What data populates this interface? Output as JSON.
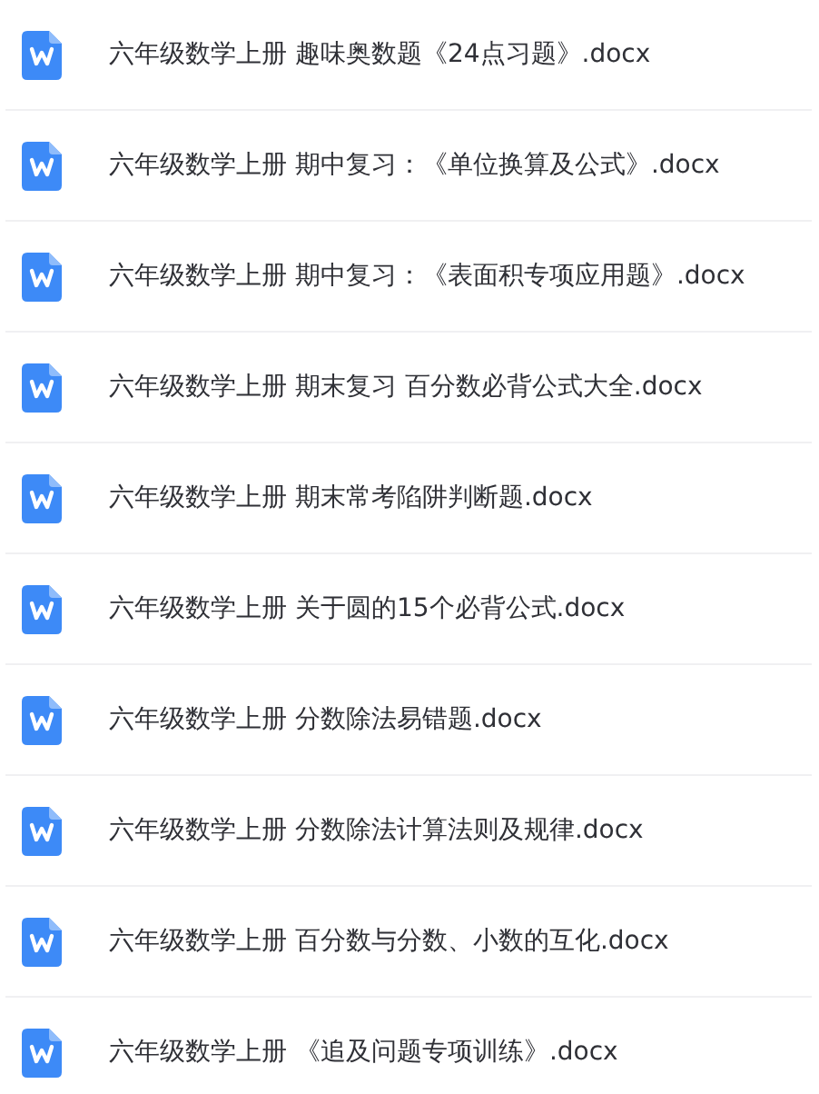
{
  "files": [
    {
      "name": "六年级数学上册 趣味奥数题《24点习题》.docx"
    },
    {
      "name": "六年级数学上册 期中复习：《单位换算及公式》.docx"
    },
    {
      "name": "六年级数学上册 期中复习：《表面积专项应用题》.docx"
    },
    {
      "name": "六年级数学上册 期末复习 百分数必背公式大全.docx"
    },
    {
      "name": "六年级数学上册 期末常考陷阱判断题.docx"
    },
    {
      "name": "六年级数学上册 关于圆的15个必背公式.docx"
    },
    {
      "name": "六年级数学上册 分数除法易错题.docx"
    },
    {
      "name": "六年级数学上册 分数除法计算法则及规律.docx"
    },
    {
      "name": "六年级数学上册 百分数与分数、小数的互化.docx"
    },
    {
      "name": "六年级数学上册 《追及问题专项训练》.docx"
    }
  ]
}
